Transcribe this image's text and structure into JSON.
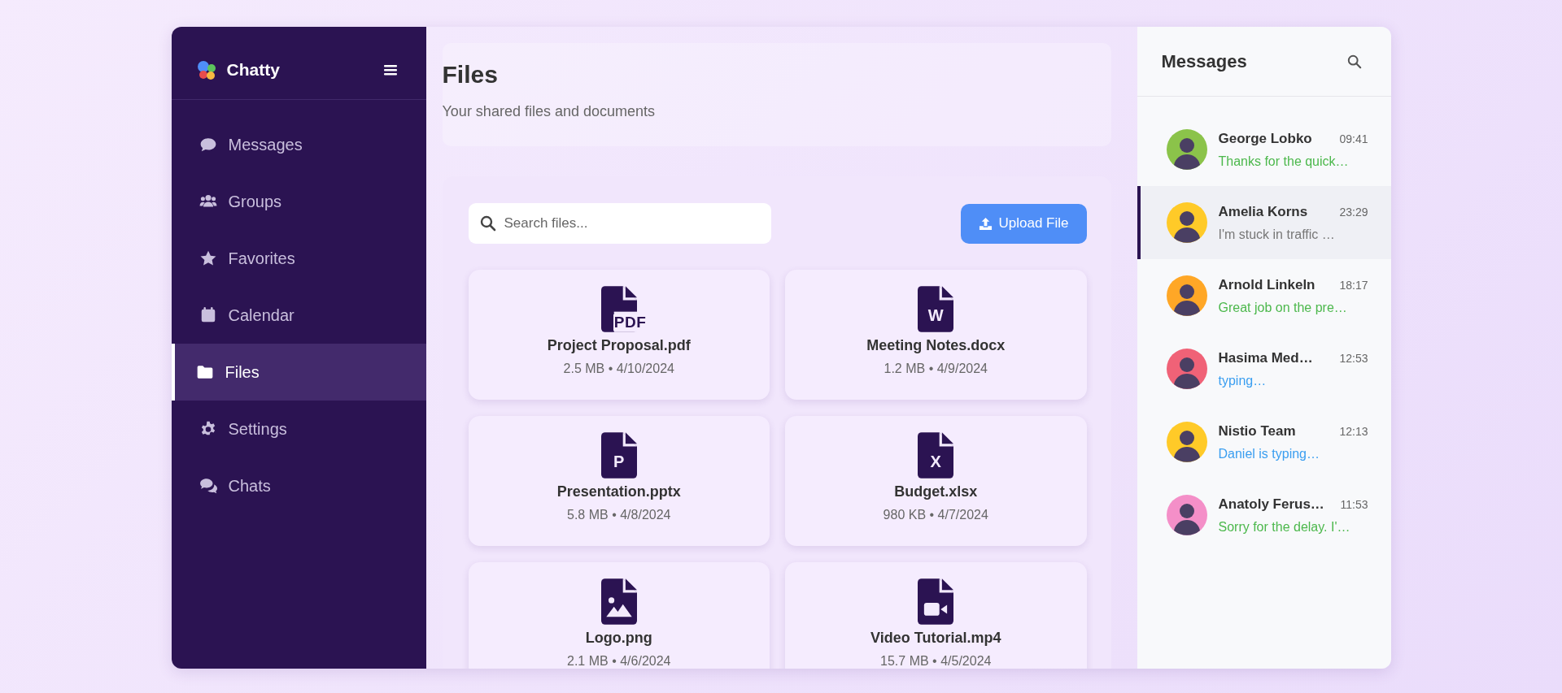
{
  "sidebar": {
    "brand": "Chatty",
    "items": [
      {
        "label": "Messages",
        "selected": false
      },
      {
        "label": "Groups",
        "selected": false
      },
      {
        "label": "Favorites",
        "selected": false
      },
      {
        "label": "Calendar",
        "selected": false
      },
      {
        "label": "Files",
        "selected": true
      },
      {
        "label": "Settings",
        "selected": false
      },
      {
        "label": "Chats",
        "selected": false
      }
    ]
  },
  "main": {
    "title": "Files",
    "subtitle": "Your shared files and documents",
    "search": {
      "placeholder": "Search files..."
    },
    "upload_button": "Upload File",
    "files": [
      {
        "name": "Project Proposal.pdf",
        "meta": "2.5 MB • 4/10/2024",
        "kind": "pdf",
        "badge": "PDF"
      },
      {
        "name": "Meeting Notes.docx",
        "meta": "1.2 MB • 4/9/2024",
        "kind": "letter",
        "badge": "W"
      },
      {
        "name": "Presentation.pptx",
        "meta": "5.8 MB • 4/8/2024",
        "kind": "letter",
        "badge": "P"
      },
      {
        "name": "Budget.xlsx",
        "meta": "980 KB • 4/7/2024",
        "kind": "letter",
        "badge": "X"
      },
      {
        "name": "Logo.png",
        "meta": "2.1 MB • 4/6/2024",
        "kind": "image"
      },
      {
        "name": "Video Tutorial.mp4",
        "meta": "15.7 MB • 4/5/2024",
        "kind": "video"
      }
    ]
  },
  "messages": {
    "title": "Messages",
    "conversations": [
      {
        "name": "George Lobko",
        "time": "09:41",
        "preview": "Thanks for the quick…",
        "kind": "unread",
        "color": "#8bc34a",
        "selected": false
      },
      {
        "name": "Amelia Korns",
        "time": "23:29",
        "preview": "I'm stuck in traffic …",
        "kind": "read",
        "color": "#ffca28",
        "selected": true
      },
      {
        "name": "Arnold Linkeln",
        "time": "18:17",
        "preview": "Great job on the pre…",
        "kind": "unread",
        "color": "#ffa726",
        "selected": false
      },
      {
        "name": "Hasima Med…",
        "time": "12:53",
        "preview": "typing…",
        "kind": "typing",
        "color": "#f06277",
        "selected": false
      },
      {
        "name": "Nistio Team",
        "time": "12:13",
        "preview": "Daniel is typing…",
        "kind": "typing",
        "color": "#ffca28",
        "selected": false
      },
      {
        "name": "Anatoly Ferus…",
        "time": "11:53",
        "preview": "Sorry for the delay. I'…",
        "kind": "unread",
        "color": "#f48fc8",
        "selected": false
      }
    ]
  }
}
